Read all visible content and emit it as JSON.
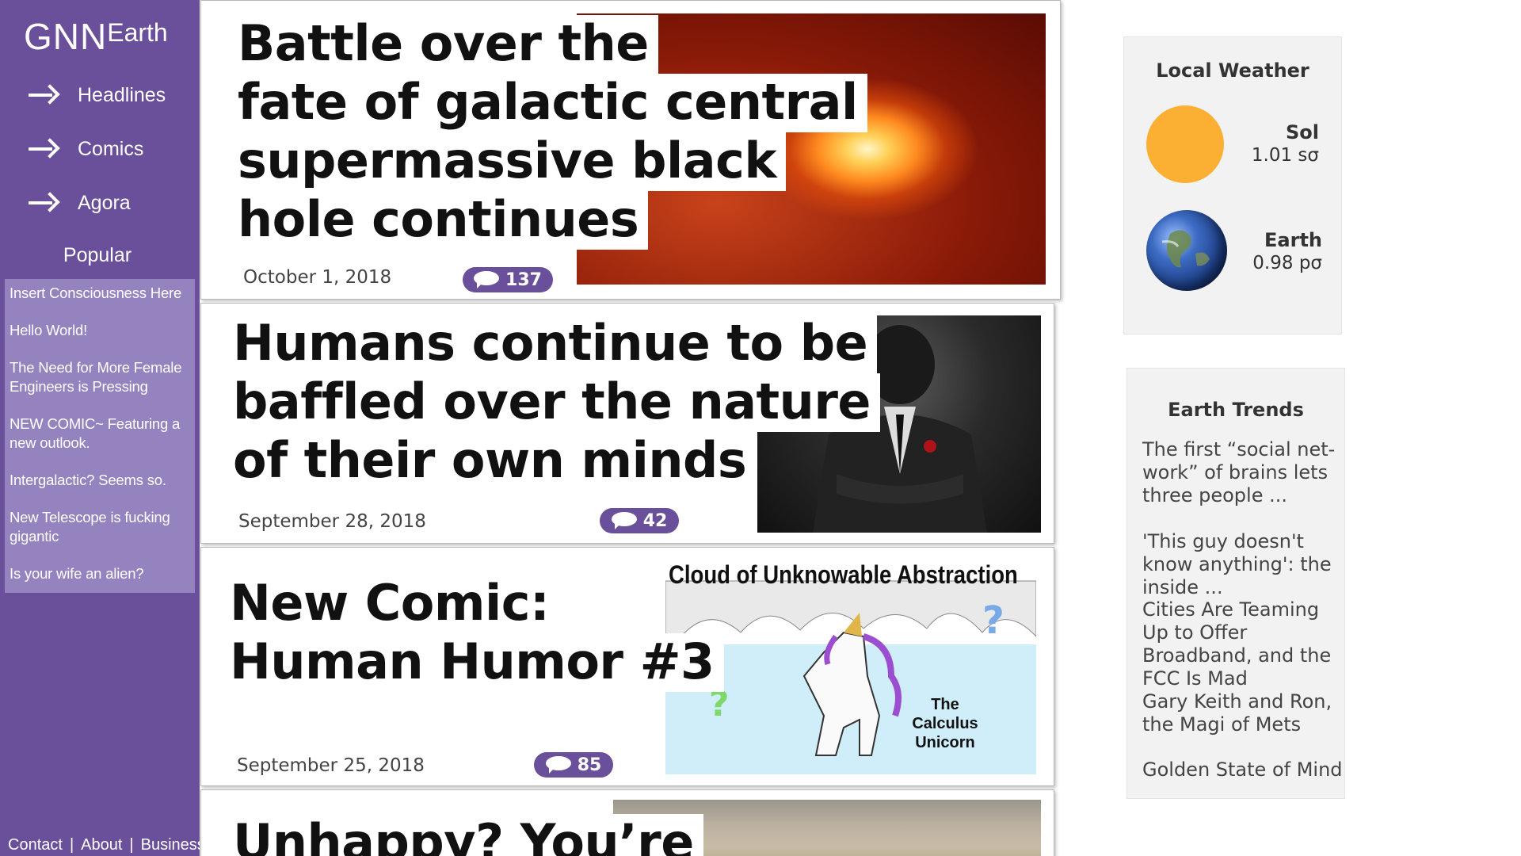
{
  "sidebar": {
    "logo_main": "GNN",
    "logo_sub": "Earth",
    "nav": [
      {
        "label": "Headlines"
      },
      {
        "label": "Comics"
      },
      {
        "label": "Agora"
      }
    ],
    "popular_title": "Popular",
    "popular": [
      "Insert Consciousness Here",
      "Hello World!",
      "The Need for More Female Engineers is Pressing",
      "NEW COMIC~ Featuring a new outlook.",
      "Intergalactic? Seems so.",
      "New Telescope is fucking gigantic",
      "Is your wife an alien?"
    ],
    "footer": [
      "Contact",
      "About",
      "Business"
    ],
    "footer_sep": "|"
  },
  "articles": [
    {
      "headline_lines": [
        "Battle over the",
        "fate of galactic central",
        "supermassive black",
        "hole continues"
      ],
      "date": "October 1, 2018",
      "comments": "137",
      "image": "galactic-center-photo"
    },
    {
      "headline_lines": [
        "Humans continue to be",
        "baffled over the nature",
        "of their own minds"
      ],
      "date": "September 28, 2018",
      "comments": "42",
      "image": "gorilla-in-suit-photo"
    },
    {
      "headline_lines": [
        "New Comic:",
        "Human Humor #3"
      ],
      "date": "September 25, 2018",
      "comments": "85",
      "image": "comic-unicorn",
      "comic_title": "Cloud of Unknowable Abstraction",
      "comic_caption": "The Calculus Unicorn"
    },
    {
      "headline_lines": [
        "Unhappy? You’re"
      ],
      "image": "desert-landscape-photo"
    }
  ],
  "weather": {
    "title": "Local Weather",
    "items": [
      {
        "name": "Sol",
        "value": "1.01 sσ",
        "icon": "sun-icon",
        "color": "#fbb033"
      },
      {
        "name": "Earth",
        "value": "0.98 pσ",
        "icon": "earth-icon",
        "color": "#2f5aa8"
      }
    ]
  },
  "trends": {
    "title": "Earth Trends",
    "items": [
      "The first “social net-work” of brains lets three people ...",
      "'This guy doesn't know anything': the inside ...",
      "Cities Are Teaming Up to Offer Broadband, and the FCC Is Mad",
      "Gary Keith and Ron, the Magi of Mets",
      "Golden State of Mind"
    ]
  },
  "colors": {
    "accent": "#6a4f9a",
    "popular_bg": "#9583c0",
    "widget_bg": "#f2f2f2"
  }
}
